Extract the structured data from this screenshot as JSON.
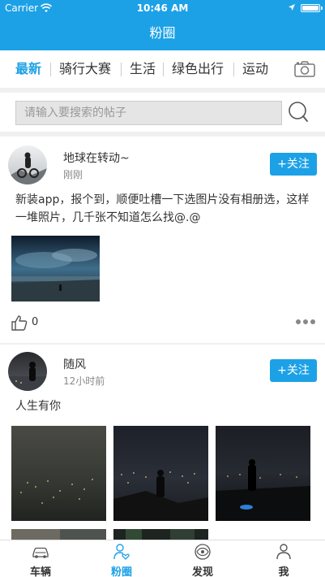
{
  "status": {
    "carrier": "Carrier",
    "time": "10:46 AM"
  },
  "nav": {
    "title": "粉圈"
  },
  "tabs": [
    "最新",
    "骑行大赛",
    "生活",
    "绿色出行",
    "运动"
  ],
  "search": {
    "placeholder": "请输入要搜索的帖子"
  },
  "posts": [
    {
      "username": "地球在转动~",
      "time": "刚刚",
      "follow": "+关注",
      "text": "新装app，报个到，顺便吐槽一下选图片没有相册选，这样一堆照片，几千张不知道怎么找@.@",
      "likes": "0"
    },
    {
      "username": "随风",
      "time": "12小时前",
      "follow": "+关注",
      "text": "人生有你"
    }
  ],
  "tabbar": [
    "车辆",
    "粉圈",
    "发现",
    "我"
  ],
  "colors": {
    "accent": "#1da1e6"
  }
}
